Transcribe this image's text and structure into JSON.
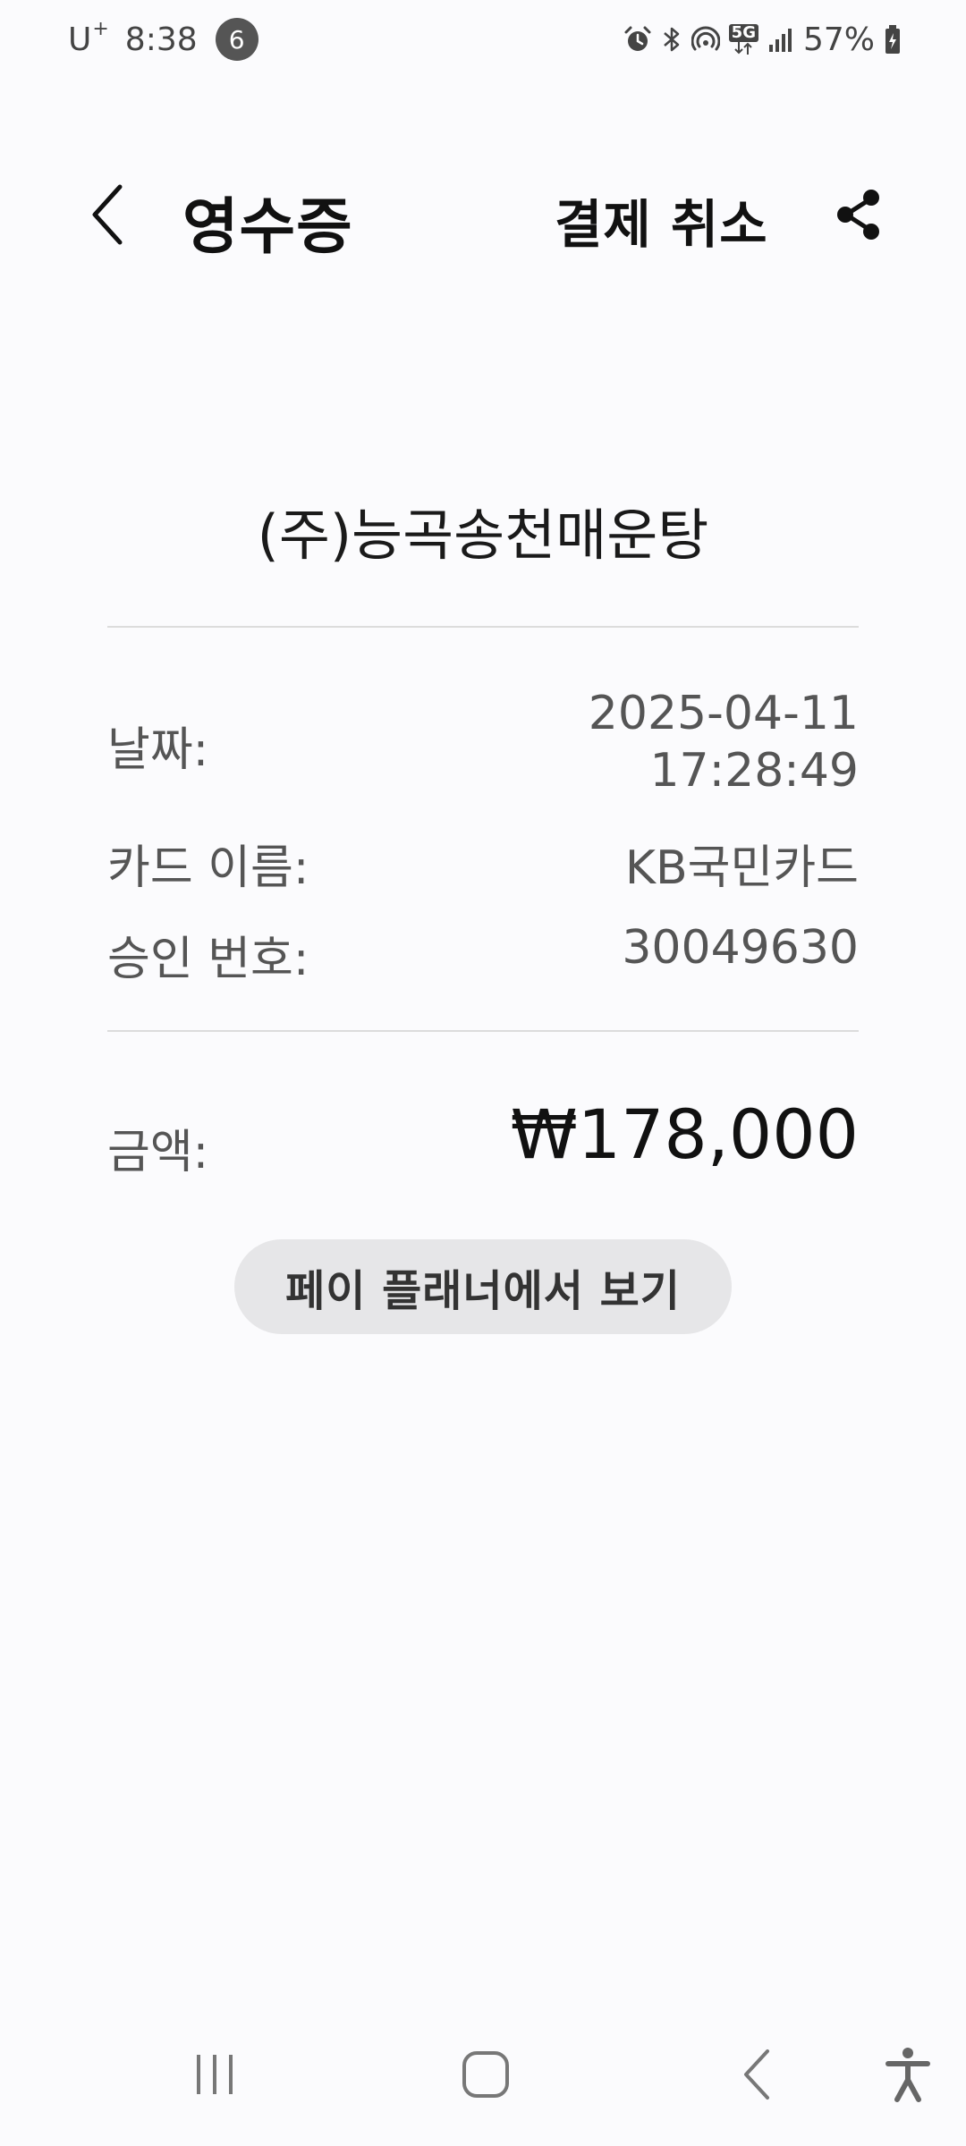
{
  "status_bar": {
    "carrier": "U",
    "carrier_sup": "+",
    "time": "8:38",
    "notification_count": "6",
    "network_label": "5G",
    "battery": "57%"
  },
  "app_bar": {
    "title": "영수증",
    "cancel_label": "결제 취소",
    "back_icon": "chevron-left-icon",
    "share_icon": "share-icon"
  },
  "receipt": {
    "merchant": "(주)능곡송천매운탕",
    "date_label": "날짜:",
    "date_value": "2025-04-11",
    "time_value": "17:28:49",
    "card_label": "카드 이름:",
    "card_value": "KB국민카드",
    "approval_label": "승인 번호:",
    "approval_value": "30049630",
    "amount_label": "금액:",
    "amount_value": "₩178,000"
  },
  "actions": {
    "planner_label": "페이 플래너에서 보기"
  },
  "nav_bar": {
    "items": [
      "recent-apps-icon",
      "home-icon",
      "back-icon",
      "accessibility-icon"
    ]
  },
  "colors": {
    "background": "#fbfbfd",
    "button_bg": "#e6e6e8",
    "divider": "#dcdcdc"
  }
}
